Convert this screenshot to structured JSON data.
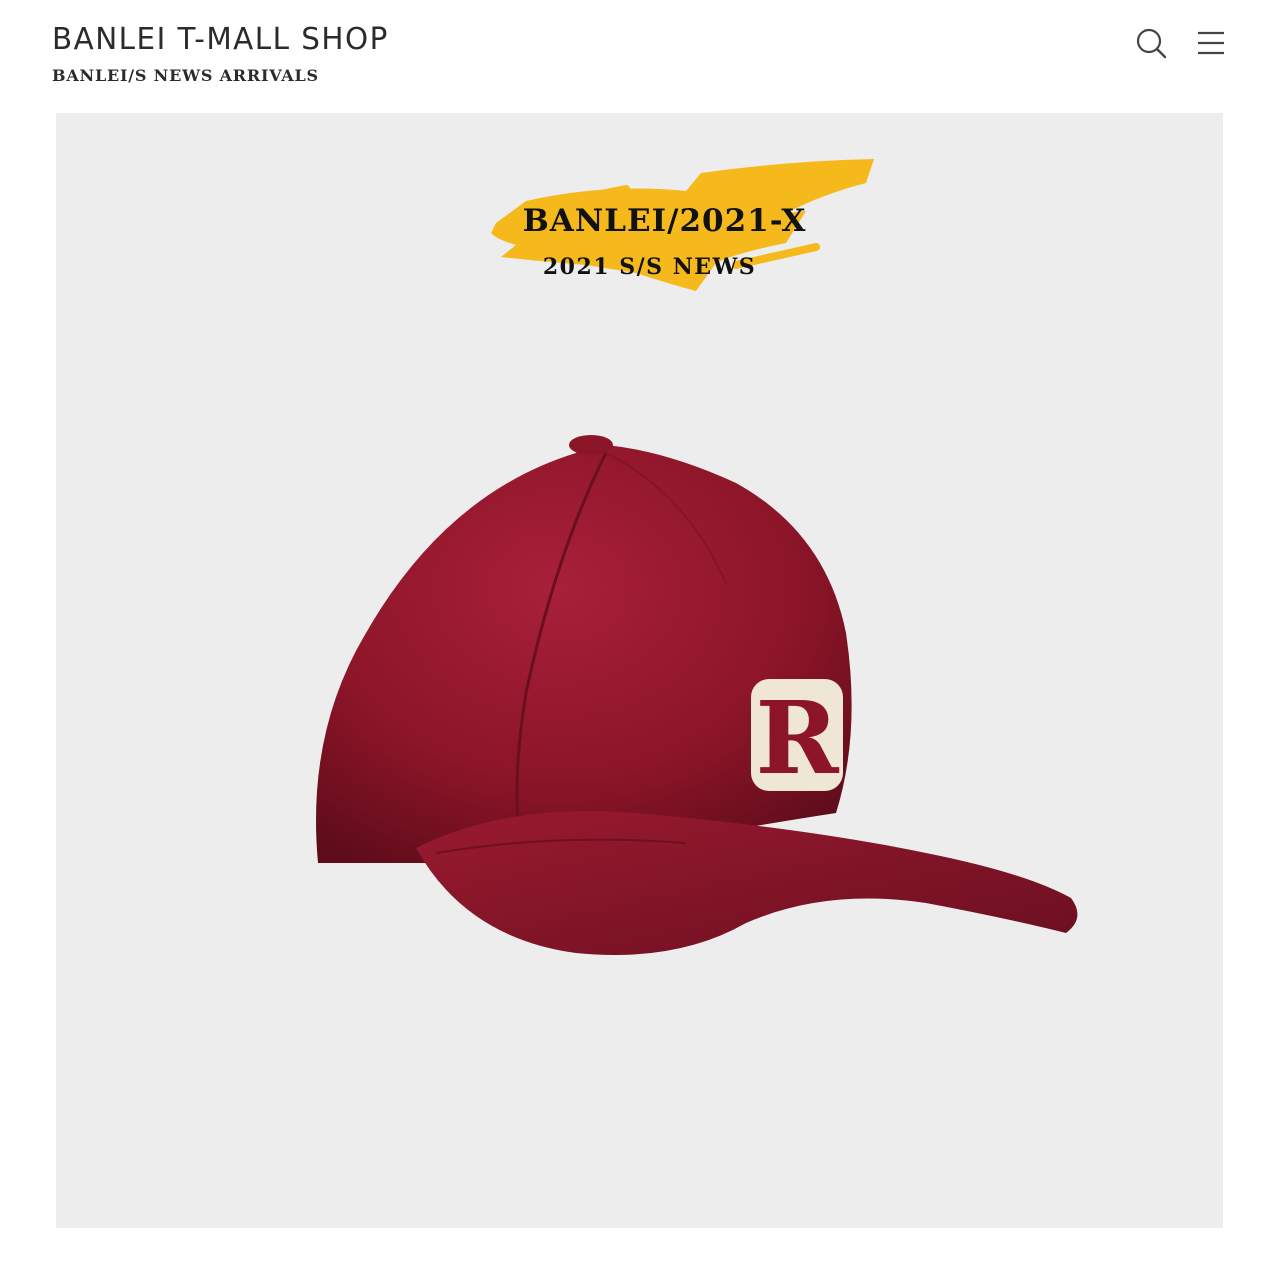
{
  "header": {
    "title": "BANLEI T-MALL SHOP",
    "subtitle": "BANLEI/S NEWS ARRIVALS",
    "icons": [
      "search-icon",
      "menu-icon"
    ]
  },
  "banner": {
    "title": "BANLEI/2021-X",
    "subtitle": "2021 S/S NEWS",
    "accent_color": "#f6b91c",
    "background_color": "#ededed"
  },
  "product": {
    "name": "baseball-cap",
    "color": "#8e1628",
    "logo_letter": "R"
  }
}
